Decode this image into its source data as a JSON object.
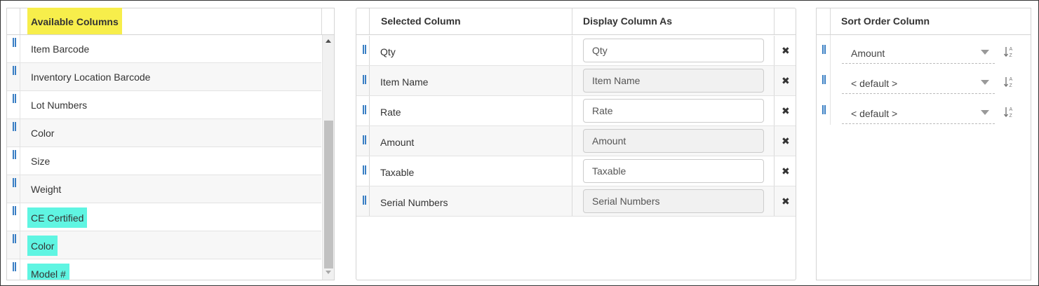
{
  "available": {
    "header": "Available Columns",
    "items": [
      {
        "label": "Item Barcode",
        "highlight": false
      },
      {
        "label": "Inventory Location Barcode",
        "highlight": false
      },
      {
        "label": "Lot Numbers",
        "highlight": false
      },
      {
        "label": "Color",
        "highlight": false
      },
      {
        "label": "Size",
        "highlight": false
      },
      {
        "label": "Weight",
        "highlight": false
      },
      {
        "label": "CE Certified",
        "highlight": true
      },
      {
        "label": "Color",
        "highlight": true
      },
      {
        "label": "Model #",
        "highlight": true
      }
    ]
  },
  "selected": {
    "header_column": "Selected Column",
    "header_display": "Display Column As",
    "rows": [
      {
        "column": "Qty",
        "display": "Qty"
      },
      {
        "column": "Item Name",
        "display": "Item Name"
      },
      {
        "column": "Rate",
        "display": "Rate"
      },
      {
        "column": "Amount",
        "display": "Amount"
      },
      {
        "column": "Taxable",
        "display": "Taxable"
      },
      {
        "column": "Serial Numbers",
        "display": "Serial Numbers"
      }
    ],
    "remove_icon": "✖"
  },
  "sort": {
    "header": "Sort Order Column",
    "rows": [
      {
        "value": "Amount"
      },
      {
        "value": "< default >"
      },
      {
        "value": "< default >"
      }
    ]
  },
  "colors": {
    "header_highlight": "#f7ee4b",
    "item_highlight": "#5ff5e2",
    "handle": "#3a7fc4"
  },
  "icons": {
    "drag_handle": "drag-handle-icon",
    "remove": "remove-x-icon",
    "sort_order": "sort-az-icon",
    "dropdown": "caret-down-icon"
  }
}
